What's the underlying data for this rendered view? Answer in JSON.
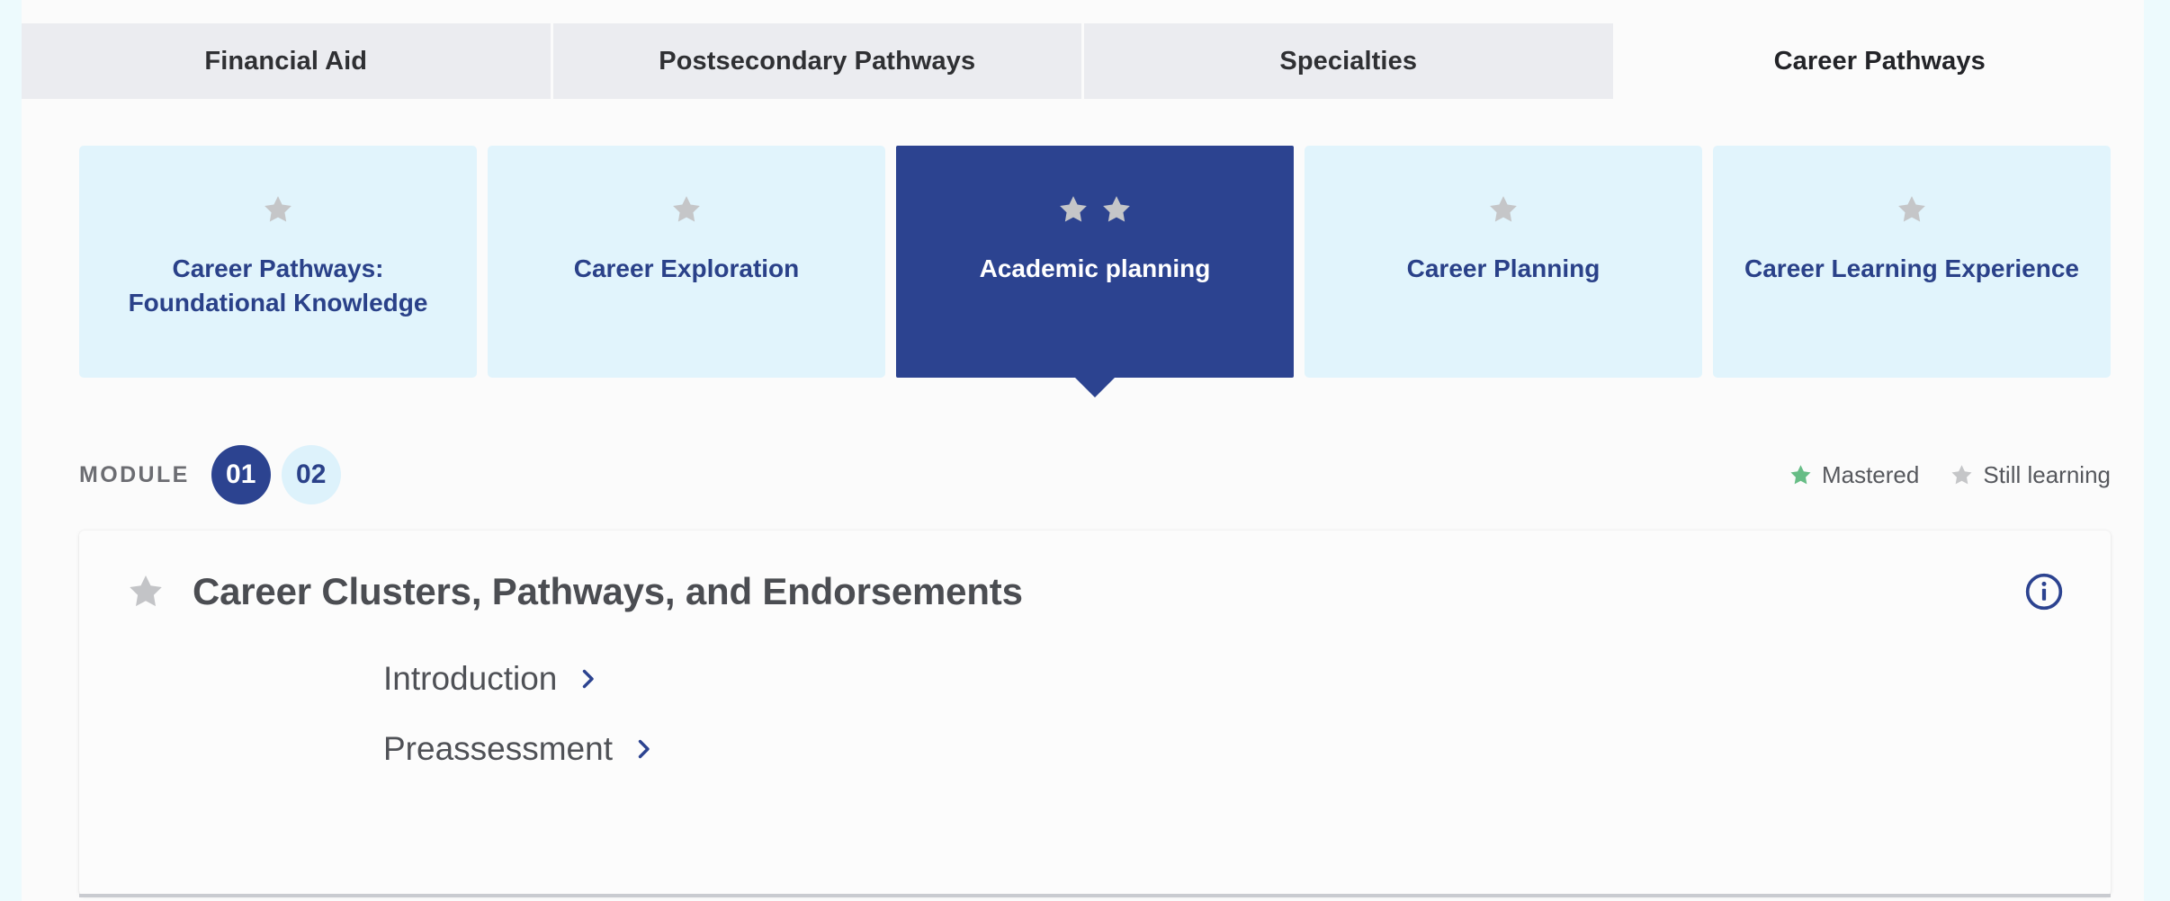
{
  "theme": {
    "page_bg": "#edfafd",
    "panel_bg": "#fbfbfb",
    "tab_bg": "#ebecf0",
    "navy": "#2c4390",
    "card_blue": "#e1f4fc",
    "star_gray": "#c5c6c8",
    "star_green": "#67bd86",
    "text_gray": "#4f5156"
  },
  "tabs": [
    {
      "label": "Financial Aid",
      "active": false
    },
    {
      "label": "Postsecondary Pathways",
      "active": false
    },
    {
      "label": "Specialties",
      "active": false
    },
    {
      "label": "Career Pathways",
      "active": true
    }
  ],
  "pathway_cards": [
    {
      "label": "Career Pathways: Foundational Knowledge",
      "stars": 1,
      "active": false
    },
    {
      "label": "Career Exploration",
      "stars": 1,
      "active": false
    },
    {
      "label": "Academic planning",
      "stars": 2,
      "active": true
    },
    {
      "label": "Career Planning",
      "stars": 1,
      "active": false
    },
    {
      "label": "Career Learning Experience",
      "stars": 1,
      "active": false
    }
  ],
  "module": {
    "label": "MODULE",
    "items": [
      {
        "number": "01",
        "selected": true
      },
      {
        "number": "02",
        "selected": false
      }
    ]
  },
  "legend": [
    {
      "label": "Mastered",
      "color": "#67bd86",
      "icon": "star-icon"
    },
    {
      "label": "Still learning",
      "color": "#c5c6c8",
      "icon": "star-icon"
    }
  ],
  "content": {
    "title": "Career Clusters, Pathways, and Endorsements",
    "title_star_state": "still-learning",
    "info_icon": "info-circle-icon",
    "items": [
      {
        "label": "Introduction",
        "chevron": "chevron-right-icon"
      },
      {
        "label": "Preassessment",
        "chevron": "chevron-right-icon"
      }
    ]
  }
}
